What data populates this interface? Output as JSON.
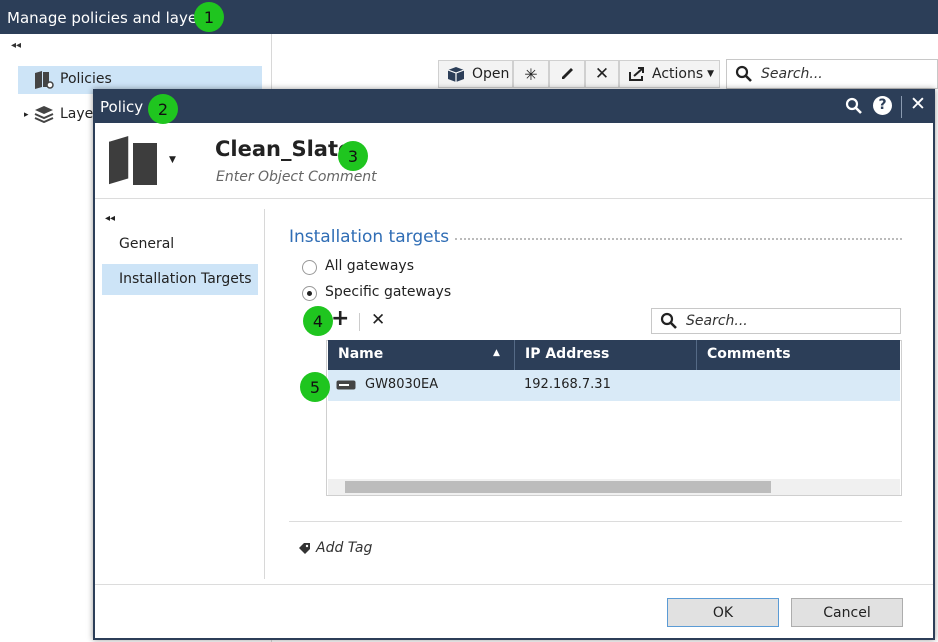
{
  "outer": {
    "title": "Manage policies and layers",
    "tree": [
      {
        "label": "Policies",
        "icon": "policy-icon"
      },
      {
        "label": "Layers",
        "icon": "layers-icon"
      }
    ],
    "toolbar": {
      "open_label": "Open",
      "actions_label": "Actions",
      "search_placeholder": "Search..."
    }
  },
  "dialog": {
    "title": "Policy",
    "object_name": "Clean_Slate",
    "comment_placeholder": "Enter Object Comment",
    "nav": [
      {
        "label": "General",
        "active": false
      },
      {
        "label": "Installation Targets",
        "active": true
      }
    ],
    "section_title": "Installation targets",
    "radio_options": [
      {
        "label": "All gateways",
        "selected": false
      },
      {
        "label": "Specific gateways",
        "selected": true
      }
    ],
    "search_placeholder": "Search...",
    "grid": {
      "columns": [
        "Name",
        "IP Address",
        "Comments"
      ],
      "rows": [
        {
          "name": "GW8030EA",
          "ip": "192.168.7.31",
          "comments": ""
        }
      ]
    },
    "add_tag_label": "Add Tag",
    "ok_label": "OK",
    "cancel_label": "Cancel"
  },
  "badges": [
    "1",
    "2",
    "3",
    "4",
    "5"
  ],
  "colors": {
    "titlebar": "#2c3e58",
    "selection": "#cde4f7",
    "badge": "#1fc51f"
  }
}
